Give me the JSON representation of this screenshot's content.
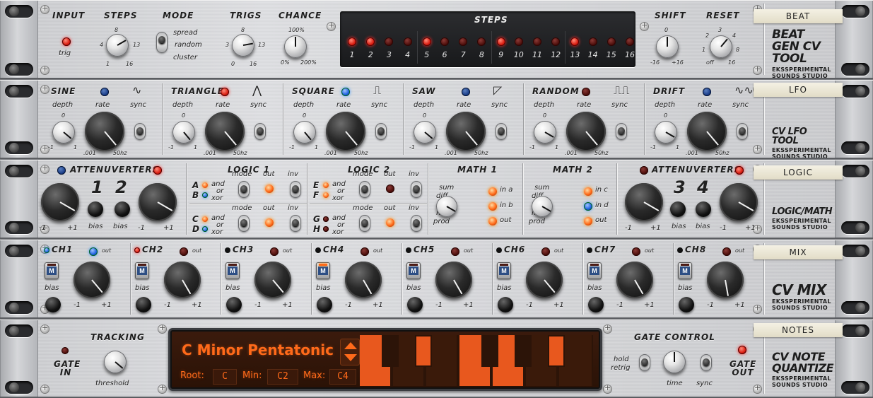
{
  "beat": {
    "tag": "BEAT",
    "brand_title": "BEAT GEN CV TOOL",
    "brand_sub": "EKSSPERIMENTAL SOUNDS STUDIO",
    "input": "INPUT",
    "trig": "trig",
    "steps": "STEPS",
    "steps_ticks": [
      "4",
      "8",
      "13",
      "1",
      "16"
    ],
    "mode": "MODE",
    "mode_opts": [
      "spread",
      "random",
      "cluster"
    ],
    "trigs": "TRIGS",
    "trigs_ticks": [
      "3",
      "8",
      "13",
      "0",
      "16"
    ],
    "chance": "CHANCE",
    "chance_ticks": [
      "100%",
      "0%",
      "200%"
    ],
    "steps_panel": "STEPS",
    "step_numbers": [
      "1",
      "2",
      "3",
      "4",
      "5",
      "6",
      "7",
      "8",
      "9",
      "10",
      "11",
      "12",
      "13",
      "14",
      "15",
      "16"
    ],
    "step_active": [
      1,
      1,
      0,
      0,
      1,
      0,
      0,
      0,
      1,
      0,
      0,
      0,
      1,
      0,
      0,
      0
    ],
    "shift": "SHIFT",
    "shift_ticks": [
      "0",
      "-16",
      "+16"
    ],
    "reset": "RESET",
    "reset_ticks": [
      "2",
      "3",
      "4",
      "1",
      "8",
      "off",
      "16"
    ]
  },
  "lfo": {
    "tag": "LFO",
    "brand_title": "CV LFO TOOL",
    "brand_sub": "EKSSPERIMENTAL SOUNDS STUDIO",
    "sections": [
      {
        "name": "SINE",
        "wave": "∿"
      },
      {
        "name": "TRIANGLE",
        "wave": "⋀"
      },
      {
        "name": "SQUARE",
        "wave": "⎍"
      },
      {
        "name": "SAW",
        "wave": "◸"
      },
      {
        "name": "RANDOM",
        "wave": "⎍⎍"
      },
      {
        "name": "DRIFT",
        "wave": "∿∿"
      }
    ],
    "depth": "depth",
    "rate": "rate",
    "sync": "sync",
    "zero": "0",
    "m1": "-1",
    "p1": "1",
    "rmin": ".001",
    "rmax": "50hz"
  },
  "logic": {
    "tag": "LOGIC",
    "brand_title": "LOGIC/MATH",
    "brand_sub": "EKSSPERIMENTAL SOUNDS STUDIO",
    "att": "ATTENUVERTERS",
    "one": "1",
    "two": "2",
    "three": "3",
    "four": "4",
    "bias": "bias",
    "m1": "-1",
    "p1": "+1",
    "logic1": "LOGIC 1",
    "logic2": "LOGIC 2",
    "mode": "mode",
    "out": "out",
    "inv": "inv",
    "and": "and",
    "or": "or",
    "xor": "xor",
    "inA": "A",
    "inB": "B",
    "inC": "C",
    "inD": "D",
    "inE": "E",
    "inF": "F",
    "inG": "G",
    "inH": "H",
    "math1": "MATH 1",
    "math2": "MATH 2",
    "ops": [
      "sum",
      "diff",
      "min",
      "max",
      "prod"
    ],
    "ina": "in a",
    "inb": "in b",
    "inc": "in c",
    "ind": "in d",
    "outl": "out"
  },
  "mix": {
    "tag": "MIX",
    "brand_title": "CV MIX",
    "brand_sub": "EKSSPERIMENTAL SOUNDS STUDIO",
    "channels": [
      "CH1",
      "CH2",
      "CH3",
      "CH4",
      "CH5",
      "CH6",
      "CH7",
      "CH8"
    ],
    "out": "out",
    "m": "M",
    "bias": "bias",
    "m1": "-1",
    "p1": "+1",
    "mute_on": [
      0,
      0,
      0,
      1,
      0,
      0,
      0,
      0
    ]
  },
  "notes": {
    "tag": "NOTES",
    "brand_title": "CV NOTE QUANTIZE",
    "brand_sub": "EKSSPERIMENTAL SOUNDS STUDIO",
    "gate_in": "GATE IN",
    "tracking": "TRACKING",
    "threshold": "threshold",
    "scale": "C Minor Pentatonic",
    "root_label": "Root:",
    "root": "C",
    "min_label": "Min:",
    "min": "C2",
    "max_label": "Max:",
    "max": "C4",
    "gate_control": "GATE CONTROL",
    "hold": "hold",
    "retrig": "retrig",
    "time": "time",
    "sync": "sync",
    "gate_out": "GATE OUT"
  },
  "colors": {
    "led_red": "#d91c10",
    "led_blue": "#1c5ee0",
    "lcd_orange": "#ff6a1a"
  }
}
